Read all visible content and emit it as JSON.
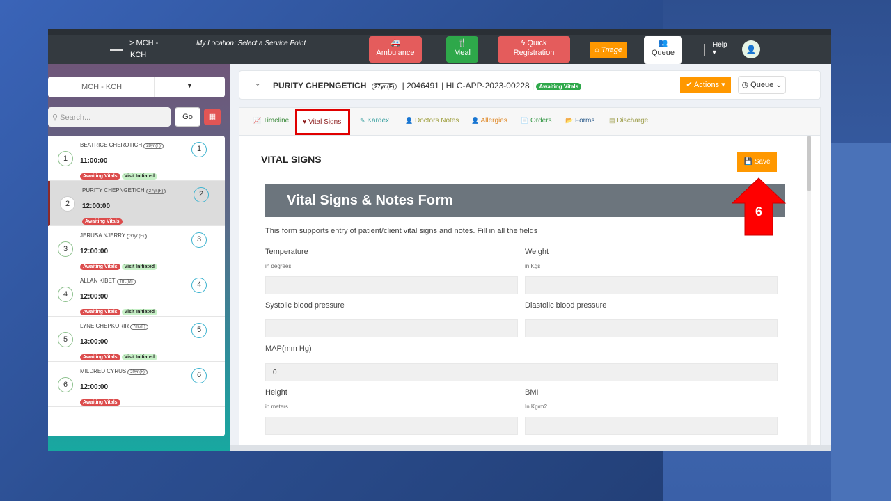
{
  "topbar": {
    "facility_line1": "MCH -",
    "facility_line2": "KCH",
    "location": "My Location: Select a Service Point",
    "buttons": {
      "ambulance": "Ambulance",
      "meal": "Meal",
      "quick_registration_1": "Quick",
      "quick_registration_2": "Registration",
      "triage": "Triage",
      "queue": "Queue",
      "help": "Help"
    }
  },
  "sidebar": {
    "facility_select": "MCH - KCH",
    "search_placeholder": "Search...",
    "go": "Go",
    "patients": [
      {
        "num": "1",
        "name": "BEATRICE CHEROTICH",
        "age": "28yr.(F)",
        "time": "11:00:00",
        "tags": [
          "Awaiting Vitals",
          "Visit Initiated"
        ]
      },
      {
        "num": "2",
        "name": "PURITY CHEPNGETICH",
        "age": "27yr.(F)",
        "time": "12:00:00",
        "tags": [
          "Awaiting Vitals"
        ]
      },
      {
        "num": "3",
        "name": "JERUSA NJERRY",
        "age": "31yr.(F)",
        "time": "12:00:00",
        "tags": [
          "Awaiting Vitals",
          "Visit Initiated"
        ]
      },
      {
        "num": "4",
        "name": "ALLAN KIBET",
        "age": "7m.(M)",
        "time": "12:00:00",
        "tags": [
          "Awaiting Vitals",
          "Visit Initiated"
        ]
      },
      {
        "num": "5",
        "name": "LYNE CHEPKORIR",
        "age": "7m.(F)",
        "time": "13:00:00",
        "tags": [
          "Awaiting Vitals",
          "Visit Initiated"
        ]
      },
      {
        "num": "6",
        "name": "MILDRED CYRUS",
        "age": "20yr.(F)",
        "time": "12:00:00",
        "tags": [
          "Awaiting Vitals"
        ]
      }
    ]
  },
  "patient": {
    "name": "PURITY CHEPNGETICH",
    "age": "27yr.(F)",
    "id": "2046491",
    "appointment": "HLC-APP-2023-00228",
    "status": "Awaiting Vitals",
    "actions": "Actions",
    "queue": "Queue"
  },
  "tabs": [
    {
      "label": "Timeline",
      "color": "#3a8a3a"
    },
    {
      "label": "Vital Signs",
      "color": "#8b1a1a"
    },
    {
      "label": "Kardex",
      "color": "#3aa0a0"
    },
    {
      "label": "Doctors Notes",
      "color": "#a0a040"
    },
    {
      "label": "Allergies",
      "color": "#e08a2a"
    },
    {
      "label": "Orders",
      "color": "#3a9a4a"
    },
    {
      "label": "Forms",
      "color": "#2a5a8a"
    },
    {
      "label": "Discharge",
      "color": "#a0a050"
    }
  ],
  "form": {
    "section_title": "VITAL SIGNS",
    "save": "Save",
    "banner": "Vital Signs & Notes Form",
    "description": "This form supports entry of patient/client vital signs and notes. Fill in all the fields",
    "temperature": "Temperature",
    "temperature_hint": "in degrees",
    "weight": "Weight",
    "weight_hint": "in Kgs",
    "systolic": "Systolic blood pressure",
    "diastolic": "Diastolic blood pressure",
    "map": "MAP(mm Hg)",
    "map_value": "0",
    "height": "Height",
    "height_hint": "in meters",
    "bmi": "BMI",
    "bmi_hint": "In Kg/m2"
  },
  "annotation": {
    "step": "6",
    "color": "#ff0000"
  }
}
